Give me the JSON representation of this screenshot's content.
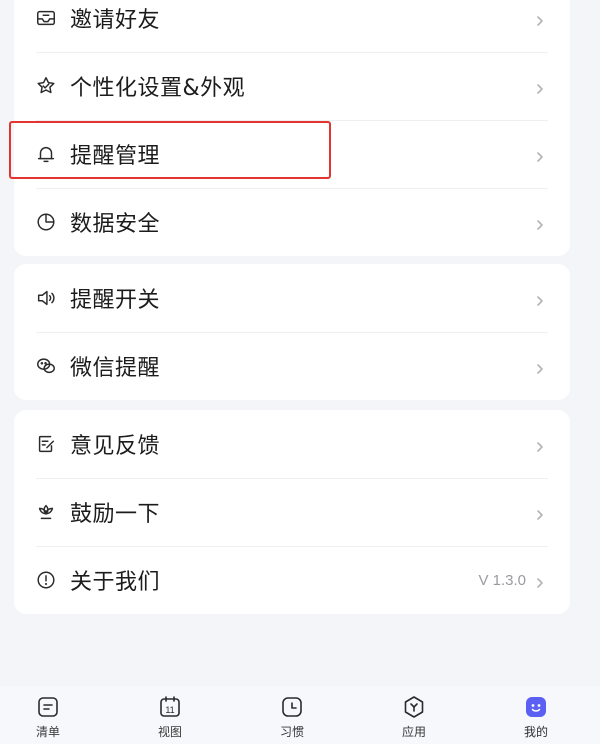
{
  "group1": {
    "items": [
      {
        "label": "邀请好友",
        "icon": "invite-mail-icon"
      },
      {
        "label": "个性化设置&外观",
        "icon": "personalize-star-icon"
      },
      {
        "label": "提醒管理",
        "icon": "bell-icon"
      },
      {
        "label": "数据安全",
        "icon": "pie-chart-icon"
      }
    ]
  },
  "group2": {
    "items": [
      {
        "label": "提醒开关",
        "icon": "speaker-icon"
      },
      {
        "label": "微信提醒",
        "icon": "wechat-icon"
      }
    ]
  },
  "group3": {
    "items": [
      {
        "label": "意见反馈",
        "icon": "feedback-edit-icon"
      },
      {
        "label": "鼓励一下",
        "icon": "lotus-icon"
      },
      {
        "label": "关于我们",
        "icon": "info-icon",
        "value": "V 1.3.0"
      }
    ]
  },
  "tabbar": {
    "tabs": [
      {
        "label": "清单",
        "icon": "list-icon"
      },
      {
        "label": "视图",
        "icon": "calendar-icon",
        "icon_text": "11"
      },
      {
        "label": "习惯",
        "icon": "clock-icon"
      },
      {
        "label": "应用",
        "icon": "apps-hexagon-icon"
      },
      {
        "label": "我的",
        "icon": "profile-face-icon",
        "active": true
      }
    ]
  },
  "colors": {
    "accent": "#5b5ff2",
    "highlight_border": "#e3342f",
    "background": "#f4f5f9"
  }
}
